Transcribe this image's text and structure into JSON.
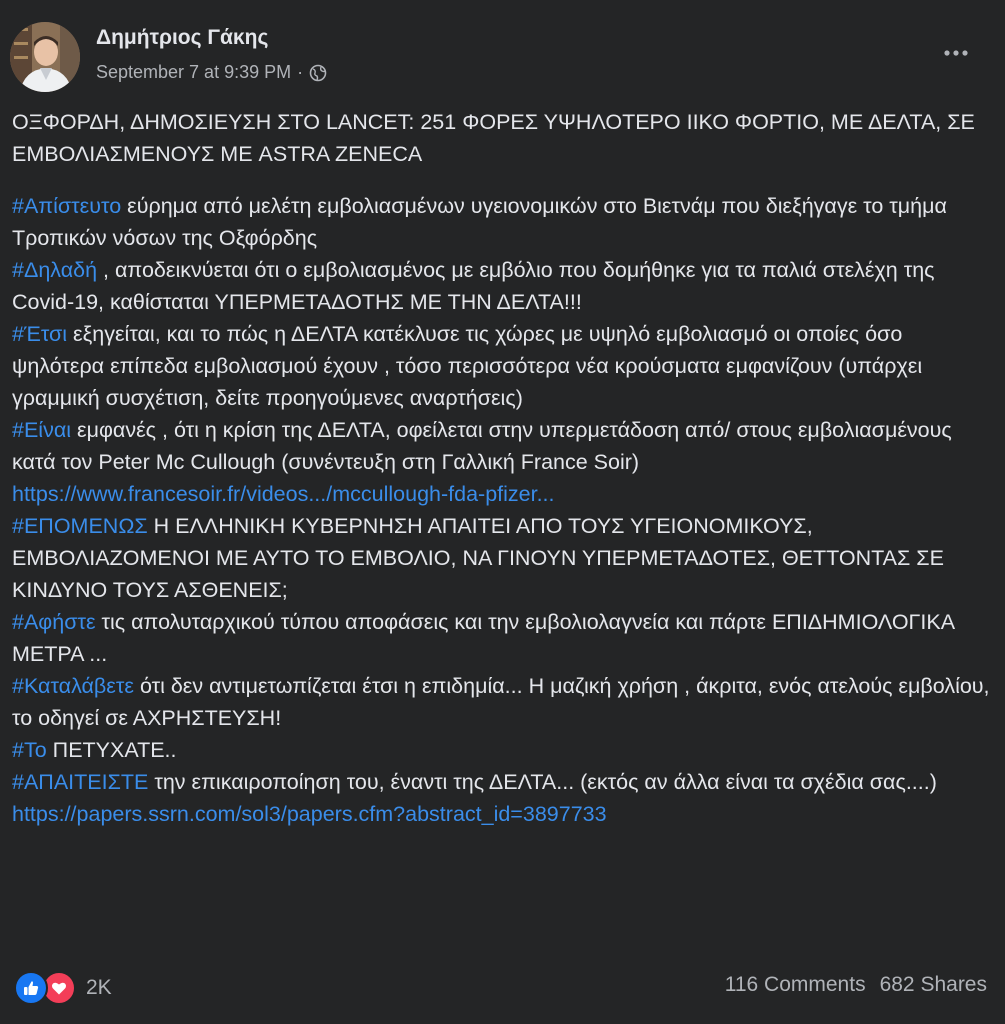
{
  "post": {
    "author": "Δημήτριος Γάκης",
    "timestamp": "September 7 at 9:39 PM",
    "separator": "·",
    "audience_icon": "globe-icon",
    "more_icon": "more-icon",
    "headline": "ΟΞΦΟΡΔΗ, ΔΗΜΟΣΙΕΥΣΗ ΣΤΟ LANCET: 251 ΦΟΡΕΣ ΥΨΗΛΟΤΕΡΟ ΙΙΚΟ ΦΟΡΤΙΟ, ΜΕ ΔΕΛΤΑ, ΣΕ ΕΜΒΟΛΙΑΣΜΕΝΟΥΣ ΜΕ ASTRA ZENECA",
    "paragraphs": [
      {
        "tag": "#Απίστευτο",
        "text": " εύρημα από μελέτη εμβολιασμένων υγειονομικών στο Βιετνάμ που διεξήγαγε το τμήμα Τροπικών νόσων της Οξφόρδης"
      },
      {
        "tag": "#Δηλαδή",
        "text": " , αποδεικνύεται ότι ο εμβολιασμένος με εμβόλιο που δομήθηκε για τα παλιά στελέχη της Covid-19, καθίσταται ΥΠΕΡΜΕΤΑΔΟΤΗΣ ΜΕ ΤΗΝ ΔΕΛΤΑ!!!"
      },
      {
        "tag": "#Έτσι",
        "text": " εξηγείται, και το πώς η ΔΕΛΤΑ κατέκλυσε τις χώρες με υψηλό εμβολιασμό οι οποίες όσο ψηλότερα επίπεδα εμβολιασμού έχουν , τόσο περισσότερα νέα κρούσματα εμφανίζουν (υπάρχει γραμμική συσχέτιση, δείτε προηγούμενες αναρτήσεις)"
      },
      {
        "tag": "#Είναι",
        "text": " εμφανές , ότι η κρίση της ΔΕΛΤΑ, οφείλεται στην υπερμετάδοση από/ στους εμβολιασμένους κατά τον Peter Mc Cullough (συνέντευξη στη Γαλλική France Soir)"
      },
      {
        "link": "https://www.francesoir.fr/videos.../mccullough-fda-pfizer..."
      },
      {
        "tag": "#ΕΠΟΜΕΝΩΣ",
        "text": " Η ΕΛΛΗΝΙΚΗ ΚΥΒΕΡΝΗΣΗ ΑΠΑΙΤΕΙ ΑΠΟ ΤΟΥΣ ΥΓΕΙΟΝΟΜΙΚΟΥΣ, ΕΜΒΟΛΙΑΖΟΜΕΝΟΙ ΜΕ ΑΥΤΟ ΤΟ ΕΜΒΟΛΙΟ, ΝΑ ΓΙΝΟΥΝ ΥΠΕΡΜΕΤΑΔΟΤΕΣ, ΘΕΤΤΟΝΤΑΣ ΣΕ ΚΙΝΔΥΝΟ ΤΟΥΣ ΑΣΘΕΝΕΙΣ;"
      },
      {
        "tag": "#Αφήστε",
        "text": " τις απολυταρχικού τύπου αποφάσεις  και την εμβολιολαγνεία και πάρτε ΕΠΙΔΗΜΙΟΛΟΓΙΚΑ ΜΕΤΡΑ ..."
      },
      {
        "tag": "#Καταλάβετε",
        "text": " ότι δεν αντιμετωπίζεται έτσι η επιδημία... Η μαζική χρήση , άκριτα, ενός ατελούς εμβολίου, το οδηγεί σε ΑΧΡΗΣΤΕΥΣΗ!"
      },
      {
        "tag": "#Το",
        "text": " ΠΕΤΥΧΑΤΕ.."
      },
      {
        "tag": "#ΑΠΑΙΤΕΙΣΤΕ",
        "text": " την επικαιροποίηση του, έναντι της ΔΕΛΤΑ... (εκτός αν άλλα είναι τα σχέδια σας....)"
      },
      {
        "link": "https://papers.ssrn.com/sol3/papers.cfm?abstract_id=3897733"
      }
    ],
    "reactions": {
      "icons": [
        "like-icon",
        "love-icon"
      ],
      "count": "2K"
    },
    "comments": "116 Comments",
    "shares": "682 Shares"
  },
  "colors": {
    "background": "#242526",
    "text": "#e4e6eb",
    "secondary": "#b0b3b8",
    "link": "#3a8dea",
    "like": "#1877f2",
    "love": "#f33e58"
  }
}
